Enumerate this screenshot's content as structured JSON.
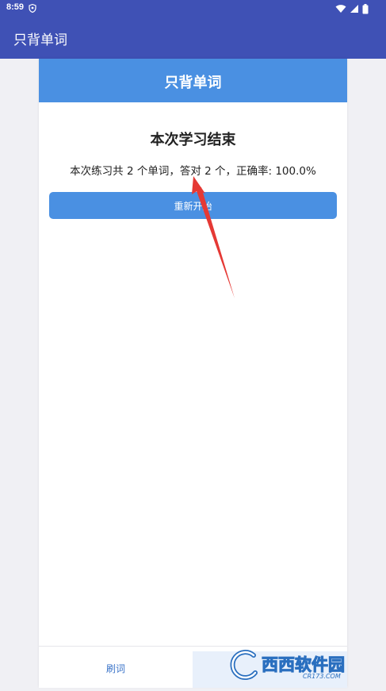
{
  "status_bar": {
    "time": "8:59",
    "icons": [
      "shield-icon",
      "wifi-icon",
      "signal-icon",
      "battery-icon"
    ]
  },
  "app_bar": {
    "title": "只背单词"
  },
  "card": {
    "header_title": "只背单词",
    "result_title": "本次学习结束",
    "result_summary": "本次练习共 2 个单词，答对 2 个，正确率: 100.0%",
    "restart_label": "重新开始"
  },
  "bottom_nav": {
    "items": [
      {
        "label": "刷词"
      }
    ]
  },
  "watermark": {
    "brand": "西西软件园",
    "site": "CR173.COM"
  },
  "colors": {
    "app_bar": "#3f51b5",
    "card_header": "#4a90e2",
    "button": "#4a90e2",
    "annotation_arrow": "#e53935",
    "background": "#f0f0f4"
  }
}
